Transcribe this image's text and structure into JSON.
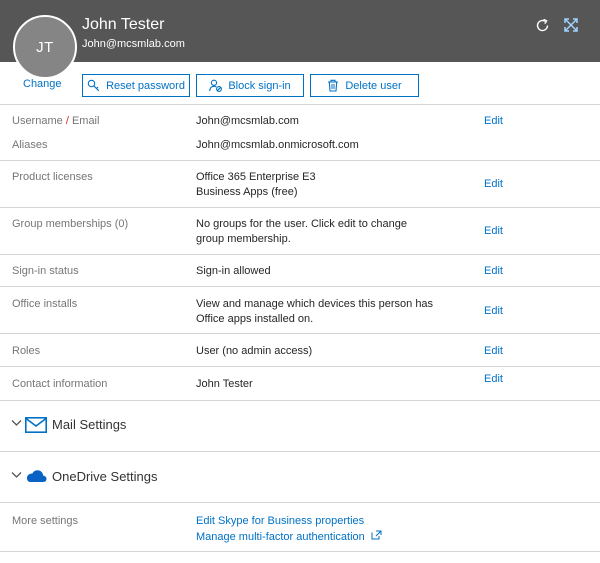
{
  "header": {
    "initials": "JT",
    "name": "John Tester",
    "email": "John@mcsmlab.com",
    "icons": [
      "refresh-icon",
      "collapse-icon"
    ]
  },
  "actions": {
    "change": "Change",
    "reset_password": "Reset password",
    "block_signin": "Block sign-in",
    "delete_user": "Delete user"
  },
  "details": {
    "username": {
      "label_a": "Username",
      "label_sep": "/",
      "label_b": "Email",
      "value": "John@mcsmlab.com",
      "edit": "Edit"
    },
    "aliases": {
      "label": "Aliases",
      "value": "John@mcsmlab.onmicrosoft.com"
    },
    "licenses": {
      "label": "Product licenses",
      "line1": "Office 365 Enterprise E3",
      "line2": "Business Apps (free)",
      "edit": "Edit"
    },
    "groups": {
      "label": "Group memberships (0)",
      "line1": "No groups for the user. Click edit to change",
      "line2": "group membership.",
      "edit": "Edit"
    },
    "signin": {
      "label": "Sign-in status",
      "value": "Sign-in allowed",
      "edit": "Edit"
    },
    "office": {
      "label": "Office installs",
      "line1": "View and manage which devices this person has",
      "line2": "Office apps installed on.",
      "edit": "Edit"
    },
    "roles": {
      "label": "Roles",
      "value": "User (no admin access)",
      "edit": "Edit"
    },
    "contact": {
      "label": "Contact information",
      "value": "John Tester",
      "edit": "Edit"
    }
  },
  "sections": {
    "mail": "Mail Settings",
    "onedrive": "OneDrive Settings"
  },
  "more": {
    "label": "More settings",
    "skype": "Edit Skype for Business properties",
    "mfa": "Manage multi-factor authentication"
  },
  "colors": {
    "header_bg": "#565656",
    "accent": "#0072c6",
    "label_gray": "#767676",
    "divider": "#d4d4d4"
  }
}
